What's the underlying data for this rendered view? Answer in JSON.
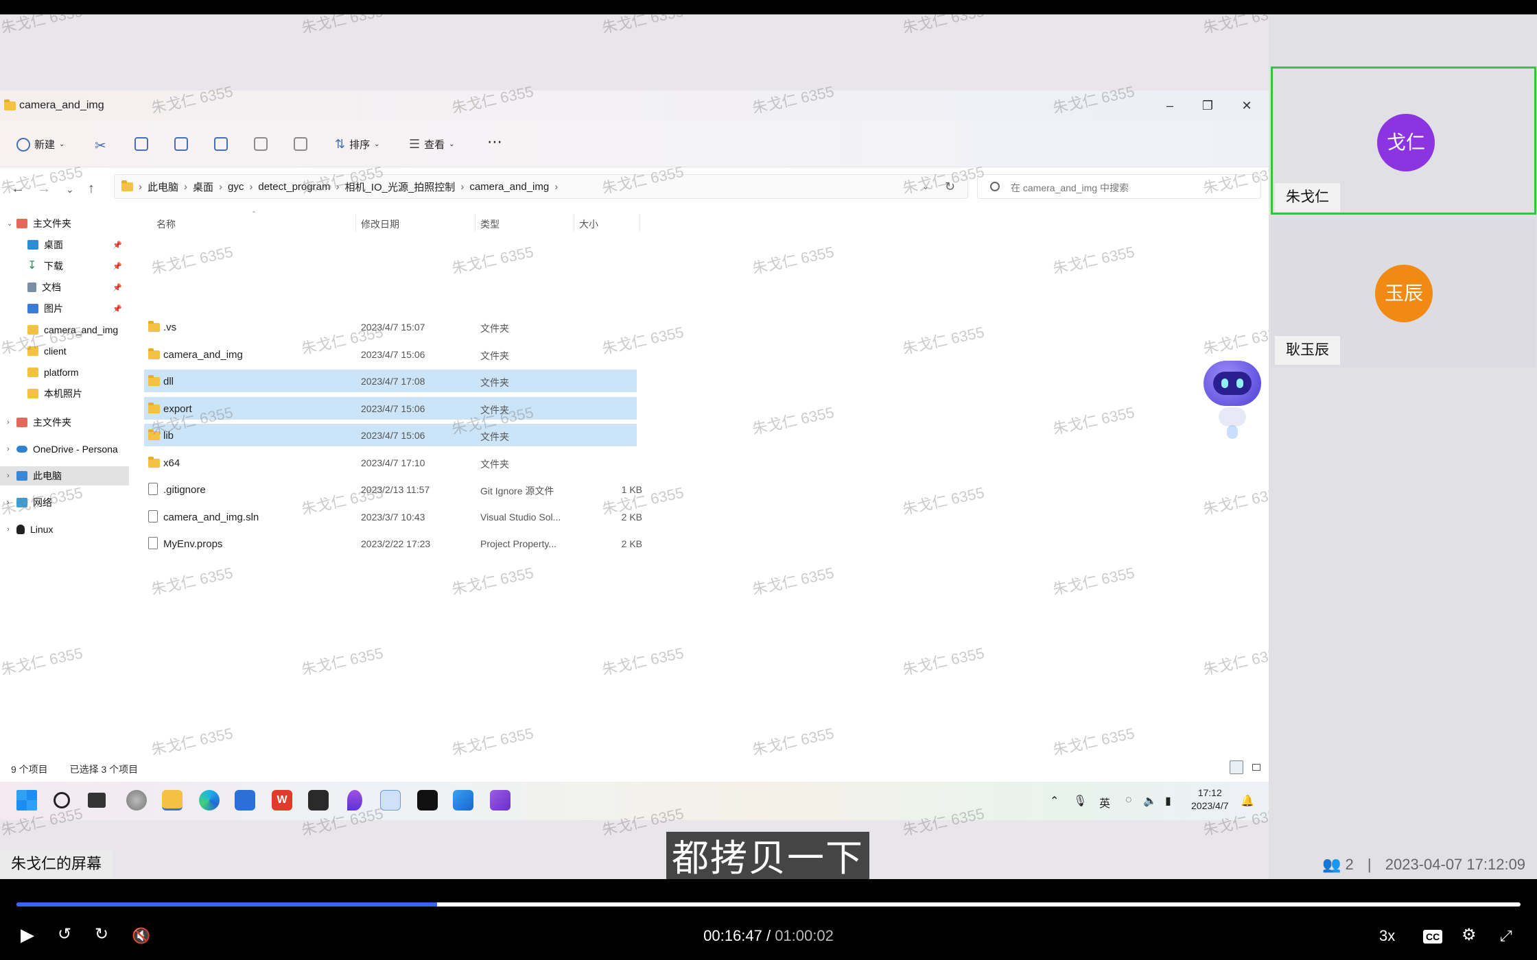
{
  "explorer": {
    "title": "camera_and_img",
    "commands": {
      "new": "新建",
      "sort": "排序",
      "view": "查看"
    },
    "breadcrumb": [
      "此电脑",
      "桌面",
      "gyc",
      "detect_program",
      "相机_IO_光源_拍照控制",
      "camera_and_img"
    ],
    "search_placeholder": "在 camera_and_img 中搜索",
    "tree": [
      {
        "label": "主文件夹",
        "icon": "home-icon"
      },
      {
        "label": "桌面",
        "icon": "desktop-icon",
        "pinned": true
      },
      {
        "label": "下载",
        "icon": "download-icon",
        "pinned": true
      },
      {
        "label": "文档",
        "icon": "document-icon",
        "pinned": true
      },
      {
        "label": "图片",
        "icon": "picture-icon",
        "pinned": true
      },
      {
        "label": "camera_and_img",
        "icon": "folder-icon"
      },
      {
        "label": "client",
        "icon": "folder-icon"
      },
      {
        "label": "platform",
        "icon": "folder-icon"
      },
      {
        "label": "本机照片",
        "icon": "folder-icon"
      },
      {
        "label": "主文件夹",
        "icon": "home-icon"
      },
      {
        "label": "OneDrive - Persona",
        "icon": "cloud-icon"
      },
      {
        "label": "此电脑",
        "icon": "pc-icon"
      },
      {
        "label": "网络",
        "icon": "network-icon"
      },
      {
        "label": "Linux",
        "icon": "linux-icon"
      }
    ],
    "columns": {
      "name": "名称",
      "date": "修改日期",
      "type": "类型",
      "size": "大小"
    },
    "files": [
      {
        "name": ".vs",
        "date": "2023/4/7 15:07",
        "type": "文件夹",
        "size": "",
        "folder": true,
        "selected": false
      },
      {
        "name": "camera_and_img",
        "date": "2023/4/7 15:06",
        "type": "文件夹",
        "size": "",
        "folder": true,
        "selected": false
      },
      {
        "name": "dll",
        "date": "2023/4/7 17:08",
        "type": "文件夹",
        "size": "",
        "folder": true,
        "selected": true
      },
      {
        "name": "export",
        "date": "2023/4/7 15:06",
        "type": "文件夹",
        "size": "",
        "folder": true,
        "selected": true
      },
      {
        "name": "lib",
        "date": "2023/4/7 15:06",
        "type": "文件夹",
        "size": "",
        "folder": true,
        "selected": true
      },
      {
        "name": "x64",
        "date": "2023/4/7 17:10",
        "type": "文件夹",
        "size": "",
        "folder": true,
        "selected": false
      },
      {
        "name": ".gitignore",
        "date": "2023/2/13 11:57",
        "type": "Git Ignore 源文件",
        "size": "1 KB",
        "folder": false,
        "selected": false
      },
      {
        "name": "camera_and_img.sln",
        "date": "2023/3/7 10:43",
        "type": "Visual Studio Sol...",
        "size": "2 KB",
        "folder": false,
        "selected": false
      },
      {
        "name": "MyEnv.props",
        "date": "2023/2/22 17:23",
        "type": "Project Property...",
        "size": "2 KB",
        "folder": false,
        "selected": false
      }
    ],
    "status": {
      "count": "9 个项目",
      "selected": "已选择 3 个项目"
    }
  },
  "taskbar": {
    "tray_lang": "英",
    "clock_time": "17:12",
    "clock_date": "2023/4/7"
  },
  "meeting": {
    "share_label": "朱戈仁的屏幕",
    "subtitle": "都拷贝一下",
    "participants_count": "2",
    "datetime": "2023-04-07 17:12:09",
    "watermark": "朱戈仁 6355",
    "participants": [
      {
        "avatar_text": "戈仁",
        "name": "朱戈仁",
        "color": "#8b34e0",
        "speaking": true
      },
      {
        "avatar_text": "玉辰",
        "name": "耿玉辰",
        "color": "#f08a13",
        "speaking": false
      }
    ]
  },
  "player": {
    "current_time": "00:16:47",
    "separator": "/",
    "total_time": "01:00:02",
    "progress": 0.2795,
    "speed": "3x",
    "cc": "CC"
  }
}
